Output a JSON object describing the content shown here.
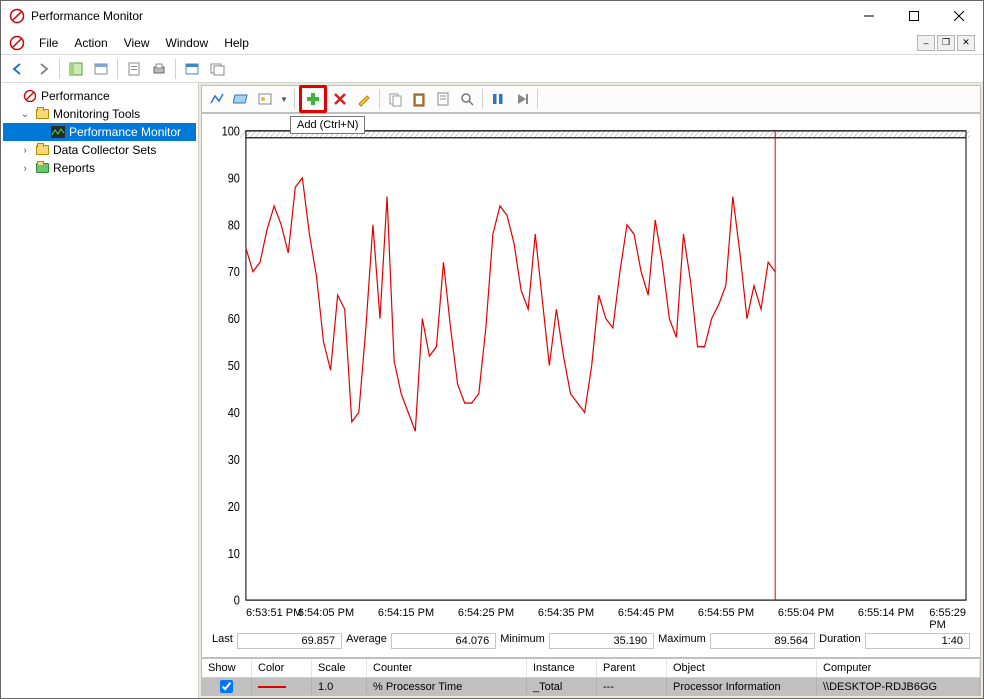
{
  "window": {
    "title": "Performance Monitor"
  },
  "menus": {
    "file": "File",
    "action": "Action",
    "view": "View",
    "window": "Window",
    "help": "Help"
  },
  "tree": {
    "root": "Performance",
    "monitoring_tools": "Monitoring Tools",
    "perf_monitor": "Performance Monitor",
    "data_collector": "Data Collector Sets",
    "reports": "Reports"
  },
  "tooltip": "Add (Ctrl+N)",
  "chart_data": {
    "type": "line",
    "yticks": [
      0,
      10,
      20,
      30,
      40,
      50,
      60,
      70,
      80,
      90,
      100
    ],
    "ylim": [
      0,
      100
    ],
    "xticks": [
      "6:53:51 PM",
      "6:54:05 PM",
      "6:54:15 PM",
      "6:54:25 PM",
      "6:54:35 PM",
      "6:54:45 PM",
      "6:54:55 PM",
      "6:55:04 PM",
      "6:55:14 PM",
      "6:55:29 PM"
    ],
    "cursor_x_fraction": 0.735,
    "series": [
      {
        "name": "% Processor Time",
        "color": "#e20000",
        "values": [
          75,
          70,
          72,
          79,
          84,
          80,
          74,
          88,
          90,
          78,
          69,
          55,
          49,
          65,
          62,
          38,
          40,
          58,
          80,
          60,
          86,
          51,
          44,
          40,
          36,
          60,
          52,
          54,
          72,
          58,
          46,
          42,
          42,
          44,
          58,
          78,
          84,
          82,
          76,
          66,
          62,
          78,
          64,
          50,
          62,
          52,
          44,
          42,
          40,
          50,
          65,
          60,
          58,
          70,
          80,
          78,
          70,
          65,
          81,
          72,
          60,
          56,
          78,
          68,
          54,
          54,
          60,
          63,
          67,
          86,
          74,
          60,
          67,
          62,
          72,
          70
        ]
      }
    ]
  },
  "stats": {
    "last_label": "Last",
    "last": "69.857",
    "avg_label": "Average",
    "avg": "64.076",
    "min_label": "Minimum",
    "min": "35.190",
    "max_label": "Maximum",
    "max": "89.564",
    "dur_label": "Duration",
    "dur": "1:40"
  },
  "grid": {
    "headers": {
      "show": "Show",
      "color": "Color",
      "scale": "Scale",
      "counter": "Counter",
      "instance": "Instance",
      "parent": "Parent",
      "object": "Object",
      "computer": "Computer"
    },
    "row": {
      "scale": "1.0",
      "counter": "% Processor Time",
      "instance": "_Total",
      "parent": "---",
      "object": "Processor Information",
      "computer": "\\\\DESKTOP-RDJB6GG"
    }
  }
}
